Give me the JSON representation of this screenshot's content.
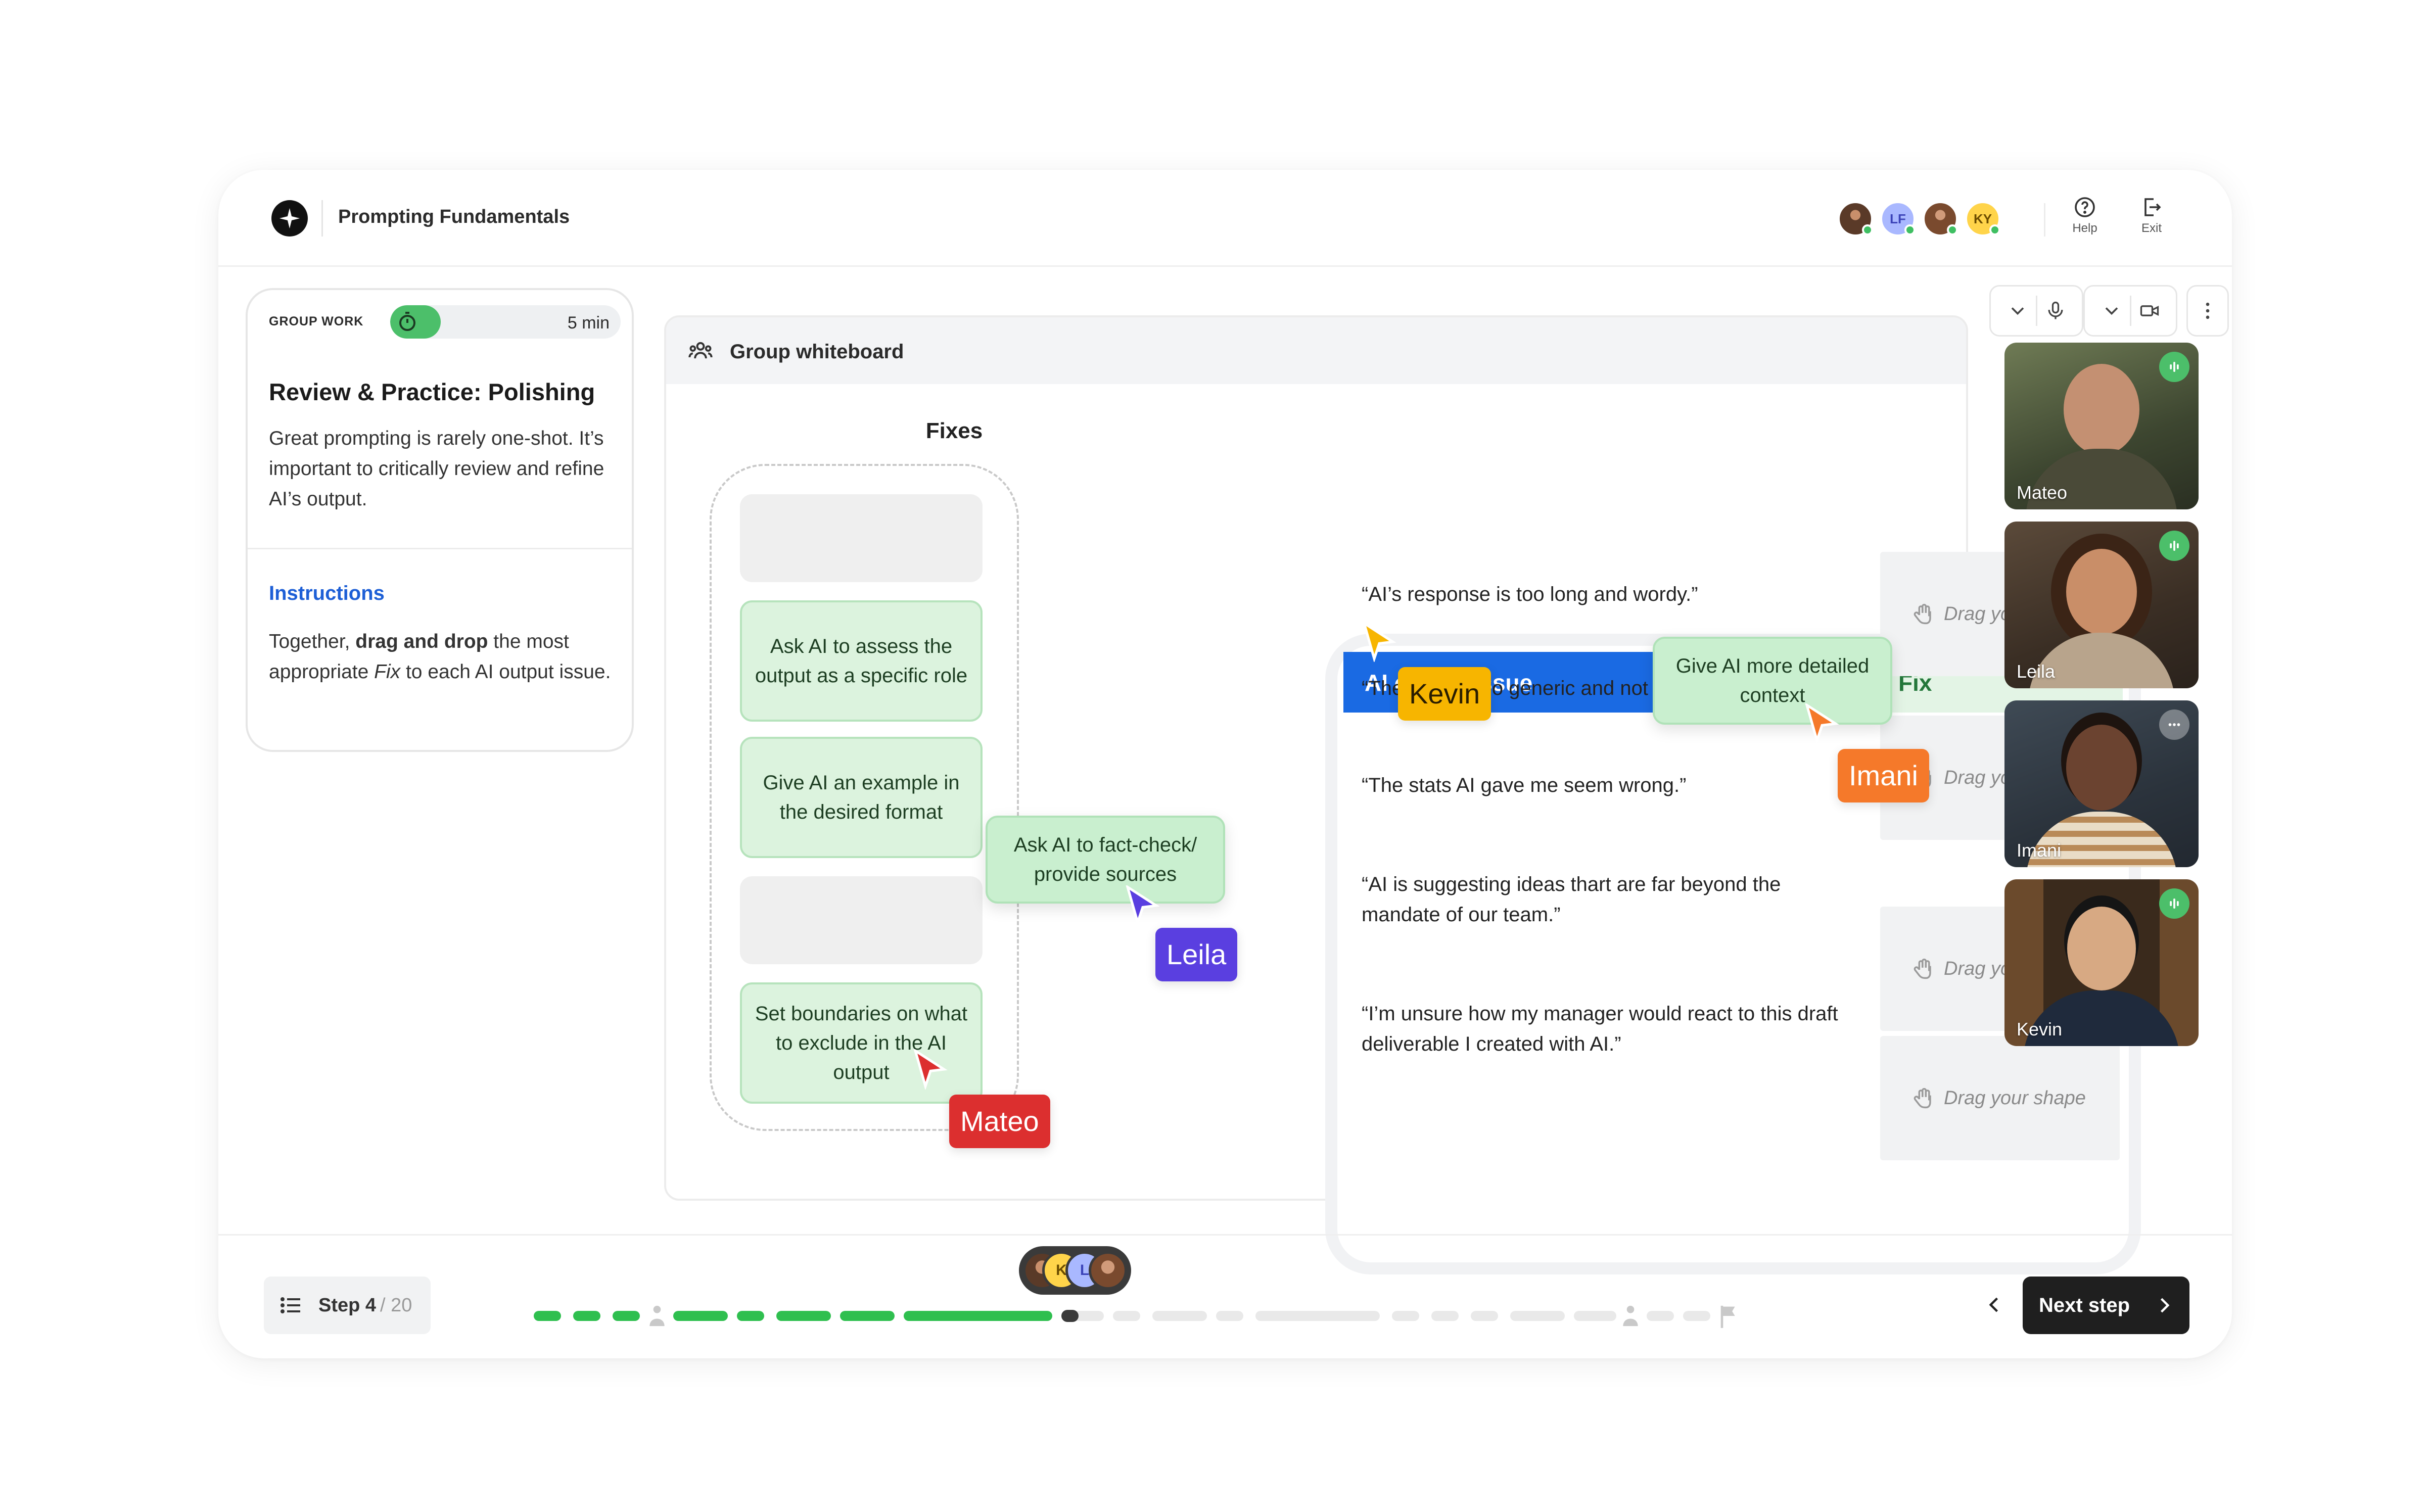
{
  "header": {
    "course_title": "Prompting Fundamentals",
    "avatars": [
      {
        "kind": "photo"
      },
      {
        "initials": "LF",
        "color": "#a9b8ff"
      },
      {
        "kind": "photo"
      },
      {
        "initials": "KY",
        "color": "#ffd44a"
      }
    ],
    "help_label": "Help",
    "exit_label": "Exit"
  },
  "activity": {
    "badge": "GROUP WORK",
    "timer_text": "5 min",
    "timer_progress": 0.1,
    "title": "Review & Practice: Polishing",
    "description": "Great prompting is rarely one-shot. It’s important to critically review and refine AI’s output.",
    "instructions_heading": "Instructions",
    "instructions": {
      "part1": "Together, ",
      "bold": "drag and drop",
      "part2": " the most appropriate ",
      "italic": "Fix",
      "part3": " to each AI output issue."
    }
  },
  "whiteboard": {
    "title": "Group whiteboard",
    "fixes_title": "Fixes",
    "fix_chips": [
      "Ask AI to assess the output as a specific role",
      "Give AI an example in the desired format",
      "Set boundaries on what to exclude in the AI output"
    ],
    "dragging_chips": [
      "Give AI more detailed context",
      "Ask AI to fact-check/ provide sources"
    ],
    "table": {
      "issue_header": "AI output issue",
      "fix_header": "Fix",
      "rows": [
        {
          "issue": "“AI’s response is too long and wordy.”"
        },
        {
          "issue": "“The draft is too generic and not relevant for me.”"
        },
        {
          "issue": "“The stats AI gave me seem wrong.”"
        },
        {
          "issue": "“AI is suggesting ideas thart are far beyond the mandate of our team.”"
        },
        {
          "issue": "“I’m unsure how my manager would react to this draft deliverable I created with AI.”"
        }
      ],
      "drop_placeholder": "Drag your shape"
    }
  },
  "cursors": [
    {
      "name": "Kevin",
      "color": "#f7b500"
    },
    {
      "name": "Imani",
      "color": "#f5792a"
    },
    {
      "name": "Leila",
      "color": "#5a3fe0"
    },
    {
      "name": "Mateo",
      "color": "#dc2f2f"
    }
  ],
  "participants": [
    {
      "name": "Mateo",
      "speaking": true
    },
    {
      "name": "Leila",
      "speaking": true
    },
    {
      "name": "Imani",
      "speaking": false
    },
    {
      "name": "Kevin",
      "speaking": true
    }
  ],
  "footer": {
    "step_label": "Step 4",
    "step_total": "/ 20",
    "next_label": "Next step",
    "progress_cluster": [
      "K",
      "L"
    ]
  },
  "colors": {
    "accent_blue": "#1a6ae3",
    "success_green": "#4cbf6a",
    "chip_green": "#dcf3de"
  }
}
